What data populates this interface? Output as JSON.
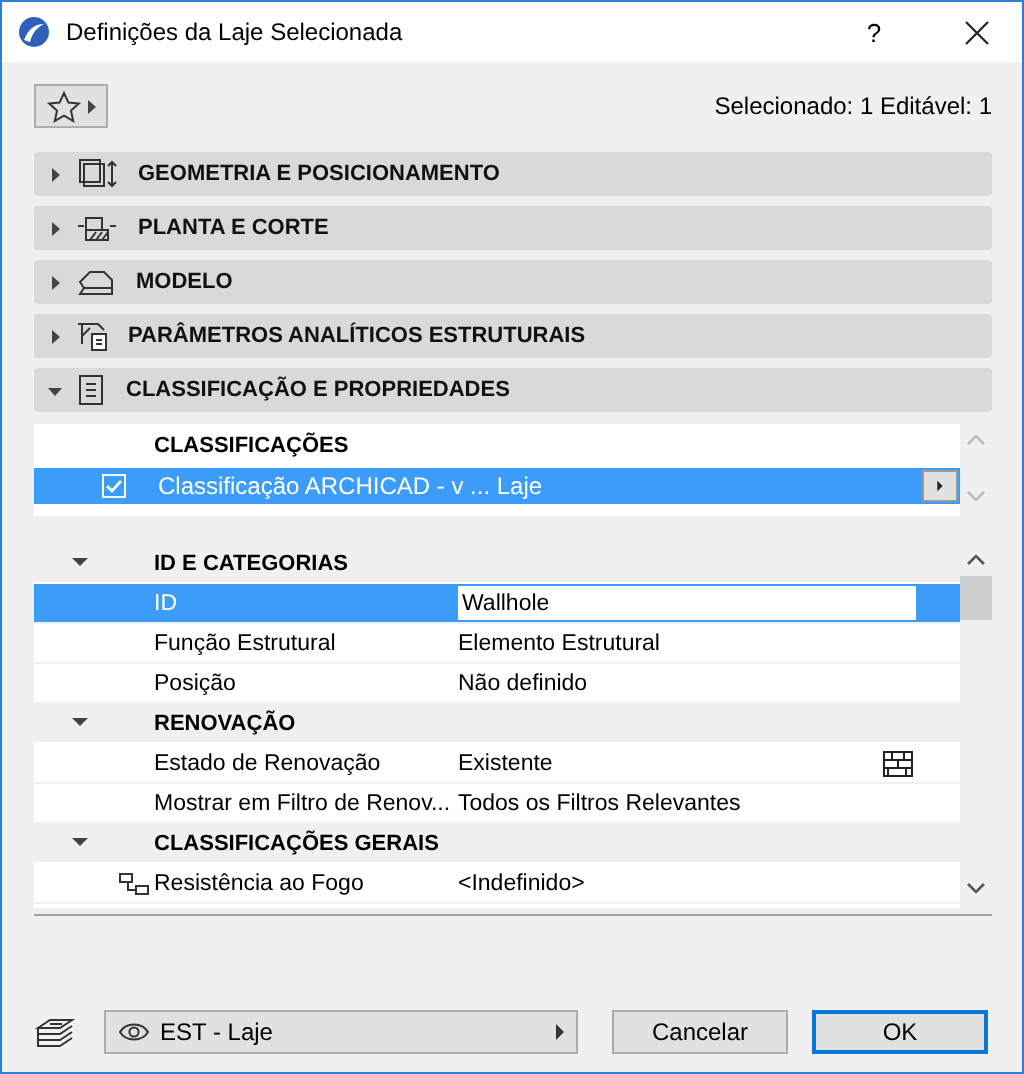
{
  "window": {
    "title": "Definições da Laje Selecionada",
    "help": "?"
  },
  "toolbar": {
    "selection_info": "Selecionado: 1 Editável: 1"
  },
  "sections": [
    {
      "label": "GEOMETRIA E POSICIONAMENTO",
      "kind": "geometry",
      "expanded": false
    },
    {
      "label": "PLANTA E CORTE",
      "kind": "plan",
      "expanded": false
    },
    {
      "label": "MODELO",
      "kind": "model",
      "expanded": false
    },
    {
      "label": "PARÂMETROS ANALÍTICOS ESTRUTURAIS",
      "kind": "analytic",
      "expanded": false
    },
    {
      "label": "CLASSIFICAÇÃO E PROPRIEDADES",
      "kind": "properties",
      "expanded": true
    }
  ],
  "classifications": {
    "header": "CLASSIFICAÇÕES",
    "rows": [
      {
        "label": "Classificação ARCHICAD - v ... Laje",
        "checked": true,
        "selected": true
      }
    ]
  },
  "properties": {
    "groups": [
      {
        "title": "ID E CATEGORIAS",
        "expanded": true,
        "rows": [
          {
            "name": "ID",
            "value": "Wallhole",
            "selected": true,
            "kind": "input"
          },
          {
            "name": "Função Estrutural",
            "value": "Elemento Estrutural",
            "selected": false,
            "kind": "text"
          },
          {
            "name": "Posição",
            "value": "Não definido",
            "selected": false,
            "kind": "text"
          }
        ]
      },
      {
        "title": "RENOVAÇÃO",
        "expanded": true,
        "rows": [
          {
            "name": "Estado de Renovação",
            "value": "Existente",
            "selected": false,
            "kind": "renovation"
          },
          {
            "name": "Mostrar em Filtro de Renov...",
            "value": "Todos os Filtros Relevantes",
            "selected": false,
            "kind": "text"
          }
        ]
      },
      {
        "title": "CLASSIFICAÇÕES GERAIS",
        "expanded": true,
        "rows": [
          {
            "name": "Resistência ao Fogo",
            "value": "<Indefinido>",
            "selected": false,
            "kind": "linked"
          }
        ]
      }
    ]
  },
  "footer": {
    "layer": "EST - Laje",
    "buttons": [
      {
        "label": "Cancelar",
        "default": false
      },
      {
        "label": "OK",
        "default": true
      }
    ]
  }
}
